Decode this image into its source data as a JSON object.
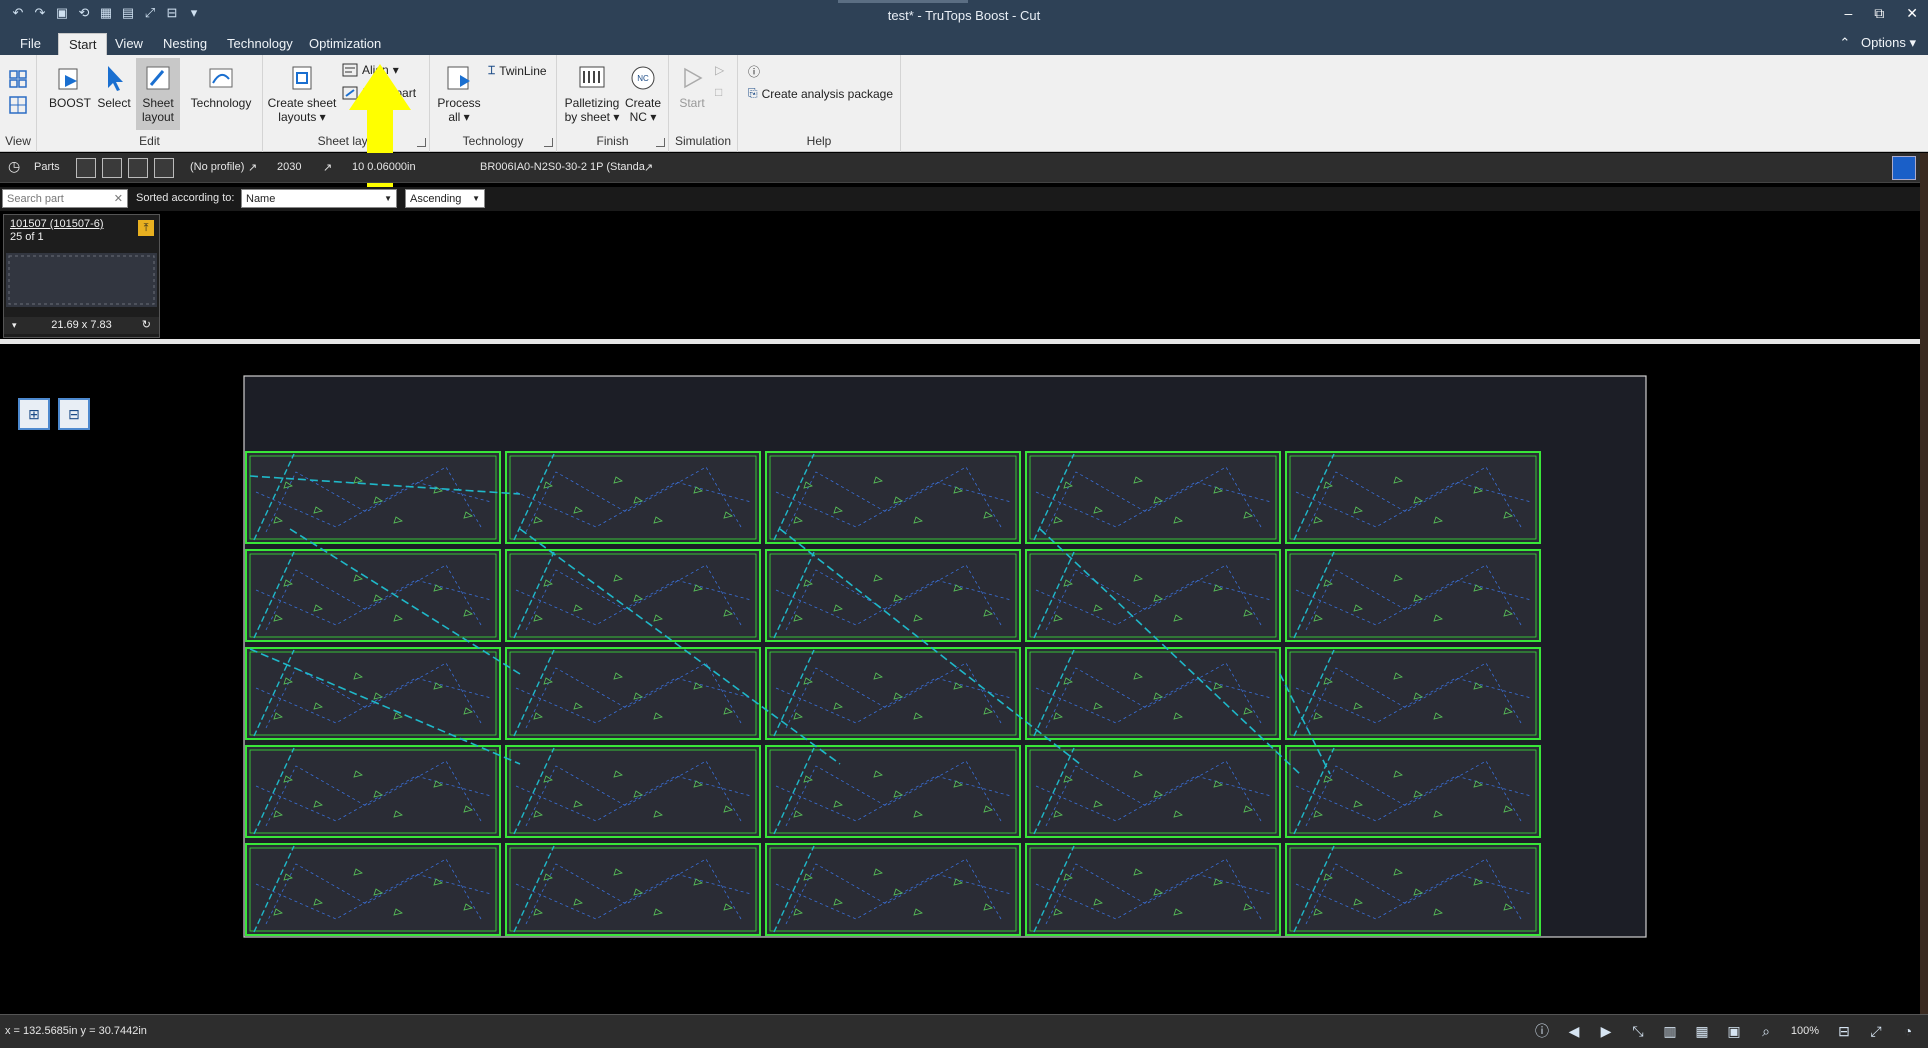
{
  "window": {
    "title": "test* - TruTops Boost - Cut",
    "controls": [
      "–",
      "⧉",
      "✕"
    ]
  },
  "menu": {
    "tabs": [
      "File",
      "Start",
      "View",
      "Nesting",
      "Technology",
      "Optimization"
    ],
    "active_tab": "Start",
    "options_label": "Options"
  },
  "ribbon": {
    "groups": {
      "view": "View",
      "edit": "Edit",
      "sheet_layout": "Sheet layo",
      "technology": "Technology",
      "finish": "Finish",
      "simulation": "Simulation",
      "help": "Help"
    },
    "buttons": {
      "boost": "BOOST",
      "select": "Select",
      "sheet_layout_1": "Sheet",
      "sheet_layout_2": "layout",
      "technology": "Technology",
      "create_sheet_1": "Create sheet",
      "create_sheet_2": "layouts",
      "align": "Align",
      "insert_part": "Insert part",
      "process_1": "Process",
      "process_2": "all",
      "twinline": "TwinLine",
      "palletizing_1": "Palletizing",
      "palletizing_2": "by sheet",
      "create_nc_1": "Create",
      "create_nc_2": "NC",
      "start": "Start",
      "analysis": "Create analysis package"
    }
  },
  "parts_bar": {
    "parts_label": "Parts",
    "profile": "(No profile)",
    "material": "2030",
    "thickness": "10  0.06000in",
    "sheet": "BR006IA0-N2S0-30-2 1P (Standa"
  },
  "filter": {
    "search_placeholder": "Search part",
    "sorted_label": "Sorted according to:",
    "sort_field": "Name",
    "sort_order": "Ascending"
  },
  "part_card": {
    "name": "101507 (101507-6)",
    "quantity": "25 of 1",
    "dimensions": "21.69 x 7.83"
  },
  "status": {
    "coords": "x =  132.5685in  y =  30.7442in",
    "zoom": "100%"
  },
  "sheet_layout": {
    "rows": 5,
    "cols": 5
  },
  "colors": {
    "part_outline": "#39e639",
    "toolpath": "#1fb8c9",
    "internal": "#3a6fd8",
    "sheet_bg": "#1c1e26",
    "accent_arrow": "#ffff00"
  }
}
